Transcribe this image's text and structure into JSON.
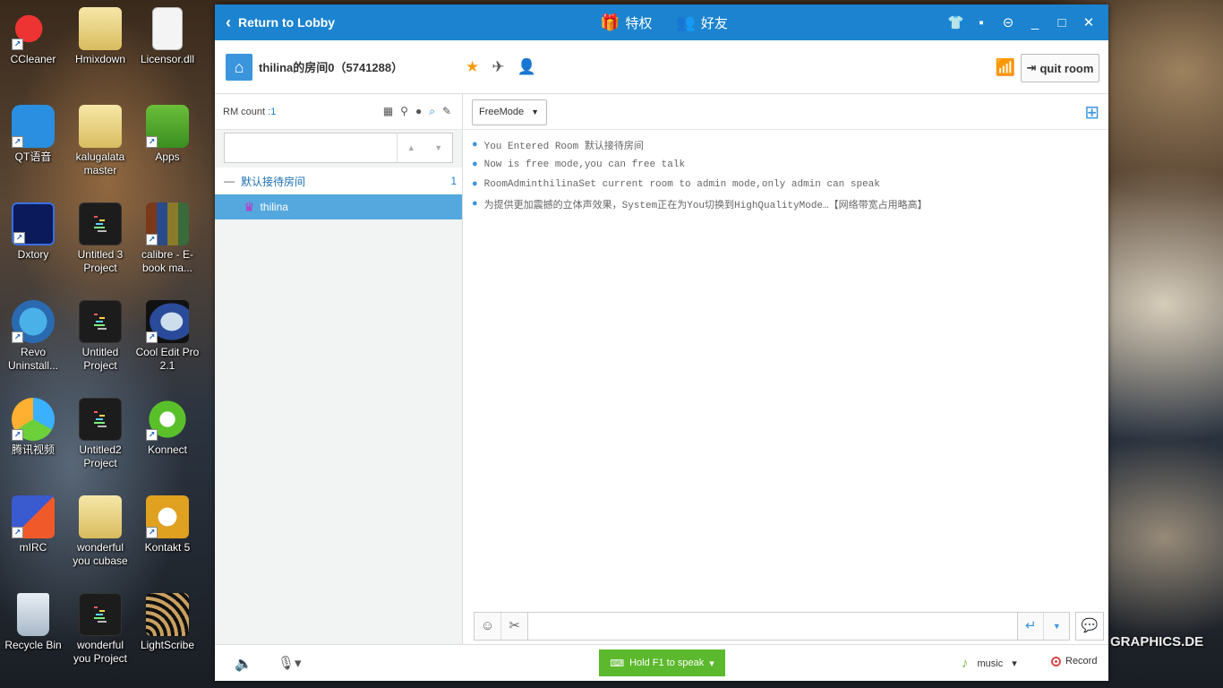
{
  "desktop": {
    "icons": [
      {
        "label": "CCleaner"
      },
      {
        "label": "Hmixdown"
      },
      {
        "label": "Licensor.dll"
      },
      {
        "label": "QT语音"
      },
      {
        "label": "kalugalata master"
      },
      {
        "label": "Apps"
      },
      {
        "label": "Dxtory"
      },
      {
        "label": "Untitled 3 Project"
      },
      {
        "label": "calibre - E-book ma..."
      },
      {
        "label": "Revo Uninstall..."
      },
      {
        "label": "Untitled Project"
      },
      {
        "label": "Cool Edit Pro 2.1"
      },
      {
        "label": "腾讯视频"
      },
      {
        "label": "Untitled2 Project"
      },
      {
        "label": "Konnect"
      },
      {
        "label": "mIRC"
      },
      {
        "label": "wonderful you cubase"
      },
      {
        "label": "Kontakt 5"
      },
      {
        "label": "Recycle Bin"
      },
      {
        "label": "wonderful you Project"
      },
      {
        "label": "LightScribe"
      }
    ],
    "watermark": "GRAPHICS.DE"
  },
  "window": {
    "back_label": "Return to Lobby",
    "center_items": [
      {
        "label": "特权",
        "icon": "gift-icon"
      },
      {
        "label": "好友",
        "icon": "friends-icon"
      }
    ],
    "controls": [
      "shirt-icon",
      "chat-icon",
      "menu-icon",
      "minimize-icon",
      "maximize-icon",
      "close-icon"
    ]
  },
  "room": {
    "name": "thilina的房间0（5741288）",
    "quit_label": "quit room"
  },
  "left_panel": {
    "rm_count_label": "RM count",
    "rm_count_value": ":1",
    "channel": {
      "name": "默认接待房间",
      "count": "1"
    },
    "user": {
      "name": "thilina"
    }
  },
  "chat": {
    "mode": "FreeMode",
    "messages": [
      "You Entered Room 默认接待房间",
      "Now is free mode,you can free talk",
      "RoomAdminthilinaSet current room to admin mode,only admin can speak",
      "为提供更加震撼的立体声效果，System正在为You切换到HighQualityMode…【网络带宽占用略高】"
    ]
  },
  "bottom": {
    "hold_label": "Hold F1 to speak",
    "music_label": "music",
    "record_label": "Record"
  },
  "colors": {
    "titlebar": "#1b83cf",
    "accent": "#3b95dd",
    "speak_button": "#5cb82c",
    "selected_user": "#55a8dd"
  }
}
